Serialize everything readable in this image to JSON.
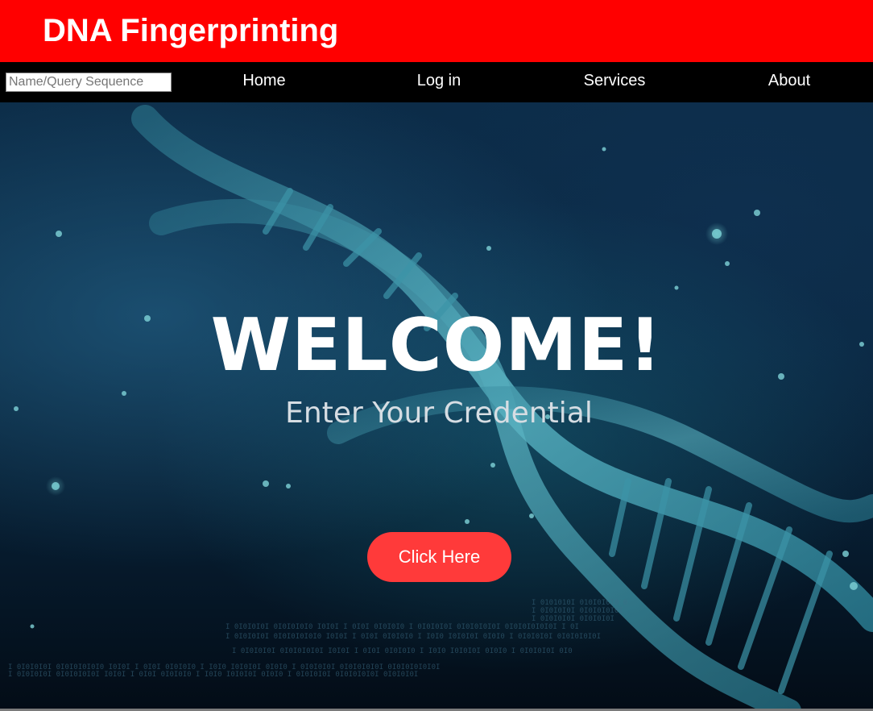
{
  "header": {
    "title": "DNA Fingerprinting",
    "background_color": "#ff0000"
  },
  "navbar": {
    "search": {
      "placeholder": "Name/Query Sequence",
      "value": ""
    },
    "links": [
      {
        "label": "Home"
      },
      {
        "label": "Log in"
      },
      {
        "label": "Services"
      },
      {
        "label": "About"
      }
    ]
  },
  "hero": {
    "background_image": "dna-double-helix-dark-blue",
    "heading": "WELCOME!",
    "subheading": "Enter Your Credential",
    "button_label": "Click Here",
    "button_color": "#ff3a3a"
  }
}
